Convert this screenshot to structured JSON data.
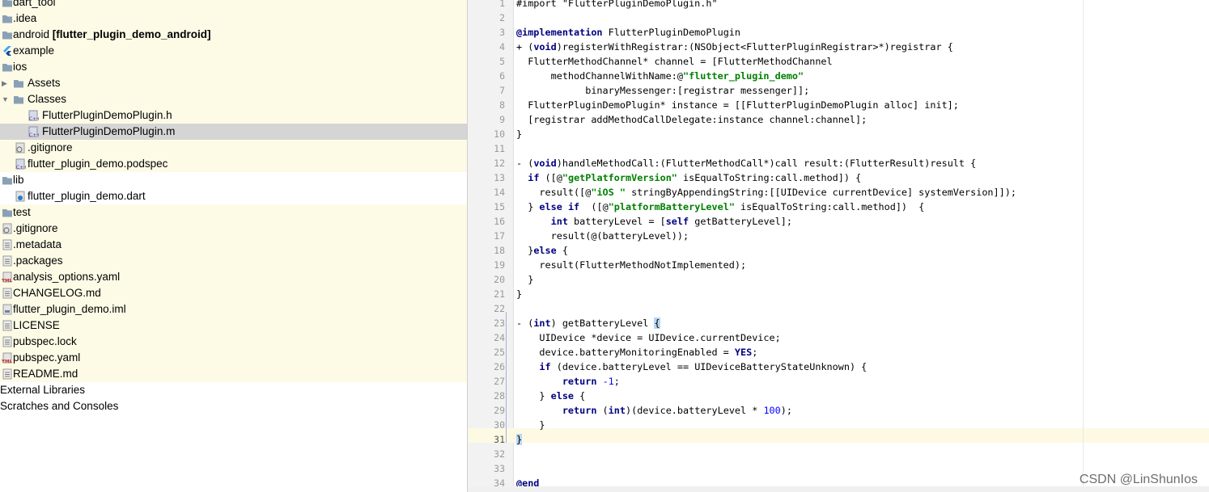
{
  "project_tree": {
    "items": [
      {
        "label": "dart_tool",
        "icon": "folder-icon",
        "hl": "yellow"
      },
      {
        "label": ".idea",
        "icon": "folder-icon",
        "hl": "yellow"
      },
      {
        "label": "android",
        "label_bold": "[flutter_plugin_demo_android]",
        "icon": "folder-icon",
        "hl": "yellow"
      },
      {
        "label": "example",
        "icon": "flutter-icon",
        "hl": "yellow"
      },
      {
        "label": "ios",
        "icon": "folder-icon",
        "hl": "yellow"
      },
      {
        "label": "Assets",
        "icon": "folder-icon",
        "hl": "yellow"
      },
      {
        "label": "Classes",
        "icon": "folder-icon",
        "hl": "yellow"
      },
      {
        "label": "FlutterPluginDemoPlugin.h",
        "icon": "cpp-file-icon",
        "hl": "yellow"
      },
      {
        "label": "FlutterPluginDemoPlugin.m",
        "icon": "cpp-file-icon",
        "hl": "selected"
      },
      {
        "label": ".gitignore",
        "icon": "ignore-file-icon",
        "hl": "yellow"
      },
      {
        "label": "flutter_plugin_demo.podspec",
        "icon": "cpp-file-icon",
        "hl": "yellow"
      },
      {
        "label": "lib",
        "icon": "folder-icon",
        "hl": "none"
      },
      {
        "label": "flutter_plugin_demo.dart",
        "icon": "dart-file-icon",
        "hl": "none"
      },
      {
        "label": "test",
        "icon": "folder-icon",
        "hl": "yellow"
      },
      {
        "label": ".gitignore",
        "icon": "ignore-file-icon",
        "hl": "yellow"
      },
      {
        "label": ".metadata",
        "icon": "text-file-icon",
        "hl": "yellow"
      },
      {
        "label": ".packages",
        "icon": "text-file-icon",
        "hl": "yellow"
      },
      {
        "label": "analysis_options.yaml",
        "icon": "yaml-file-icon",
        "hl": "yellow"
      },
      {
        "label": "CHANGELOG.md",
        "icon": "text-file-icon",
        "hl": "yellow"
      },
      {
        "label": "flutter_plugin_demo.iml",
        "icon": "iml-file-icon",
        "hl": "yellow"
      },
      {
        "label": "LICENSE",
        "icon": "text-file-icon",
        "hl": "yellow"
      },
      {
        "label": "pubspec.lock",
        "icon": "text-file-icon",
        "hl": "yellow"
      },
      {
        "label": "pubspec.yaml",
        "icon": "yaml-file-icon",
        "hl": "yellow"
      },
      {
        "label": "README.md",
        "icon": "text-file-icon",
        "hl": "yellow"
      },
      {
        "label": "External Libraries",
        "icon": "",
        "hl": "none"
      },
      {
        "label": "Scratches and Consoles",
        "icon": "",
        "hl": "none"
      }
    ]
  },
  "editor": {
    "current_line": 31,
    "lines": [
      {
        "n": "1",
        "html": "#import \"FlutterPluginDemoPlugin.h\""
      },
      {
        "n": "2",
        "html": ""
      },
      {
        "n": "3",
        "html": "@implementation FlutterPluginDemoPlugin"
      },
      {
        "n": "4",
        "html": "+ (void)registerWithRegistrar:(NSObject<FlutterPluginRegistrar>*)registrar {"
      },
      {
        "n": "5",
        "html": "  FlutterMethodChannel* channel = [FlutterMethodChannel"
      },
      {
        "n": "6",
        "html": "      methodChannelWithName:@\"flutter_plugin_demo\""
      },
      {
        "n": "7",
        "html": "            binaryMessenger:[registrar messenger]];"
      },
      {
        "n": "8",
        "html": "  FlutterPluginDemoPlugin* instance = [[FlutterPluginDemoPlugin alloc] init];"
      },
      {
        "n": "9",
        "html": "  [registrar addMethodCallDelegate:instance channel:channel];"
      },
      {
        "n": "10",
        "html": "}"
      },
      {
        "n": "11",
        "html": ""
      },
      {
        "n": "12",
        "html": "- (void)handleMethodCall:(FlutterMethodCall*)call result:(FlutterResult)result {"
      },
      {
        "n": "13",
        "html": "  if ([@\"getPlatformVersion\" isEqualToString:call.method]) {"
      },
      {
        "n": "14",
        "html": "    result([@\"iOS \" stringByAppendingString:[[UIDevice currentDevice] systemVersion]]);"
      },
      {
        "n": "15",
        "html": "  } else if  ([@\"platformBatteryLevel\" isEqualToString:call.method])  {"
      },
      {
        "n": "16",
        "html": "      int batteryLevel = [self getBatteryLevel];"
      },
      {
        "n": "17",
        "html": "      result(@(batteryLevel));"
      },
      {
        "n": "18",
        "html": "  }else {"
      },
      {
        "n": "19",
        "html": "    result(FlutterMethodNotImplemented);"
      },
      {
        "n": "20",
        "html": "  }"
      },
      {
        "n": "21",
        "html": "}"
      },
      {
        "n": "22",
        "html": ""
      },
      {
        "n": "23",
        "html": "- (int) getBatteryLevel {"
      },
      {
        "n": "24",
        "html": "    UIDevice *device = UIDevice.currentDevice;"
      },
      {
        "n": "25",
        "html": "    device.batteryMonitoringEnabled = YES;"
      },
      {
        "n": "26",
        "html": "    if (device.batteryLevel == UIDeviceBatteryStateUnknown) {"
      },
      {
        "n": "27",
        "html": "        return -1;"
      },
      {
        "n": "28",
        "html": "    } else {"
      },
      {
        "n": "29",
        "html": "        return (int)(device.batteryLevel * 100);"
      },
      {
        "n": "30",
        "html": "    }"
      },
      {
        "n": "31",
        "html": "}"
      },
      {
        "n": "32",
        "html": ""
      },
      {
        "n": "33",
        "html": ""
      },
      {
        "n": "34",
        "html": "@end"
      }
    ]
  },
  "watermark": "CSDN @LinShunIos"
}
